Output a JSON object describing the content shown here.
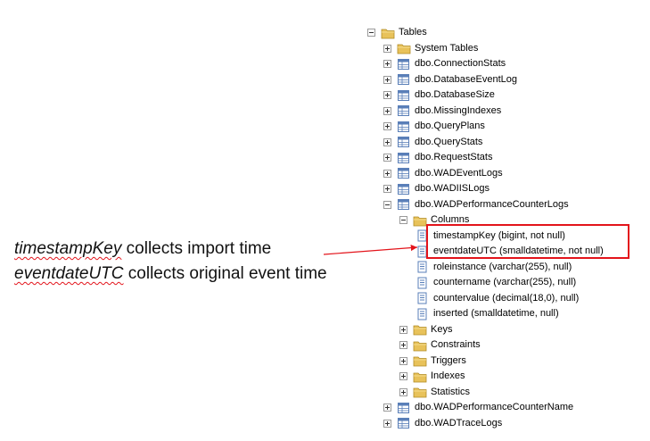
{
  "tree": {
    "rows": [
      {
        "label": "Tables",
        "icon": "folder-icon",
        "expander": "minus",
        "indent": 0
      },
      {
        "label": "System Tables",
        "icon": "folder-icon",
        "expander": "plus",
        "indent": 1
      },
      {
        "label": "dbo.ConnectionStats",
        "icon": "table-icon",
        "expander": "plus",
        "indent": 1
      },
      {
        "label": "dbo.DatabaseEventLog",
        "icon": "table-icon",
        "expander": "plus",
        "indent": 1
      },
      {
        "label": "dbo.DatabaseSize",
        "icon": "table-icon",
        "expander": "plus",
        "indent": 1
      },
      {
        "label": "dbo.MissingIndexes",
        "icon": "table-icon",
        "expander": "plus",
        "indent": 1
      },
      {
        "label": "dbo.QueryPlans",
        "icon": "table-icon",
        "expander": "plus",
        "indent": 1
      },
      {
        "label": "dbo.QueryStats",
        "icon": "table-icon",
        "expander": "plus",
        "indent": 1
      },
      {
        "label": "dbo.RequestStats",
        "icon": "table-icon",
        "expander": "plus",
        "indent": 1
      },
      {
        "label": "dbo.WADEventLogs",
        "icon": "table-icon",
        "expander": "plus",
        "indent": 1
      },
      {
        "label": "dbo.WADIISLogs",
        "icon": "table-icon",
        "expander": "plus",
        "indent": 1
      },
      {
        "label": "dbo.WADPerformanceCounterLogs",
        "icon": "table-icon",
        "expander": "minus",
        "indent": 1
      },
      {
        "label": "Columns",
        "icon": "folder-icon",
        "expander": "minus",
        "indent": 2
      },
      {
        "label": "timestampKey (bigint, not null)",
        "icon": "column-icon",
        "expander": "none",
        "indent": 3
      },
      {
        "label": "eventdateUTC (smalldatetime, not null)",
        "icon": "column-icon",
        "expander": "none",
        "indent": 3
      },
      {
        "label": "roleinstance (varchar(255), null)",
        "icon": "column-icon",
        "expander": "none",
        "indent": 3
      },
      {
        "label": "countername (varchar(255), null)",
        "icon": "column-icon",
        "expander": "none",
        "indent": 3
      },
      {
        "label": "countervalue (decimal(18,0), null)",
        "icon": "column-icon",
        "expander": "none",
        "indent": 3
      },
      {
        "label": "inserted (smalldatetime, null)",
        "icon": "column-icon",
        "expander": "none",
        "indent": 3
      },
      {
        "label": "Keys",
        "icon": "folder-icon",
        "expander": "plus",
        "indent": 2
      },
      {
        "label": "Constraints",
        "icon": "folder-icon",
        "expander": "plus",
        "indent": 2
      },
      {
        "label": "Triggers",
        "icon": "folder-icon",
        "expander": "plus",
        "indent": 2
      },
      {
        "label": "Indexes",
        "icon": "folder-icon",
        "expander": "plus",
        "indent": 2
      },
      {
        "label": "Statistics",
        "icon": "folder-icon",
        "expander": "plus",
        "indent": 2
      },
      {
        "label": "dbo.WADPerformanceCounterName",
        "icon": "table-icon",
        "expander": "plus",
        "indent": 1
      },
      {
        "label": "dbo.WADTraceLogs",
        "icon": "table-icon",
        "expander": "plus",
        "indent": 1
      }
    ]
  },
  "annotation": {
    "line1_keyword": "timestampKey",
    "line1_rest": " collects import time",
    "line2_keyword": "eventdateUTC",
    "line2_rest": " collects original event time"
  },
  "colors": {
    "highlight": "#e3141b",
    "folder": "#e8c25a",
    "table_icon": "#5a7fb8"
  }
}
